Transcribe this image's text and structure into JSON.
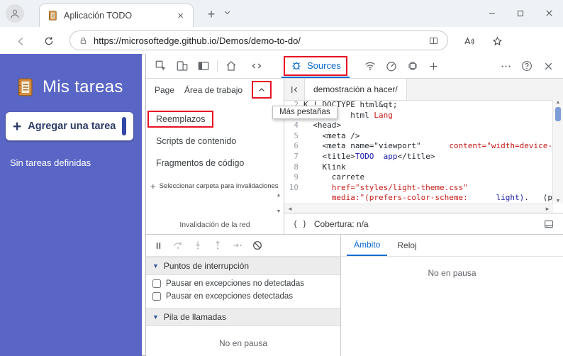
{
  "colors": {
    "accent": "#0b6bce",
    "annotation_red": "#e81123",
    "sidebar_blue": "#5a66c5",
    "string_red": "#c41a16",
    "value_blue": "#1a1aa6"
  },
  "titlebar": {
    "tab_title": "Aplicación TODO",
    "new_tab": "+",
    "tab_close": "×"
  },
  "navbar": {
    "url": "https://microsoftedge.github.io/Demos/demo-to-do/"
  },
  "todo_app": {
    "title": "Mis tareas",
    "plus": "+",
    "add_label": "Agregar una tarea",
    "empty": "Sin tareas definidas"
  },
  "devtools": {
    "toolbar": {
      "sources_label": "Sources"
    },
    "navigator": {
      "tabs": [
        "Page",
        "Área de trabajo"
      ],
      "more_tabs_tooltip": "Más pestañas",
      "items": [
        "Reemplazos",
        "Scripts de contenido",
        "Fragmentos de código"
      ],
      "select_folder_plus": "+",
      "select_folder": "Seleccionar carpeta para invalidaciones",
      "footer": "Invalidación de la red"
    },
    "editor": {
      "file_tab": "demostración a hacer/",
      "braces": "{ }",
      "coverage": "Cobertura: n/a",
      "lines": [
        {
          "num": "2",
          "segs": [
            [
              "K ! DOCTYPE html&qt;",
              "t"
            ]
          ]
        },
        {
          "num": "3",
          "segs": [
            [
              "          ",
              "t"
            ],
            [
              "html ",
              "t"
            ],
            [
              "Lang",
              "s"
            ]
          ]
        },
        {
          "num": "4",
          "segs": [
            [
              "  <head>",
              "t"
            ]
          ]
        },
        {
          "num": "5",
          "segs": [
            [
              "    <meta />",
              "t"
            ]
          ]
        },
        {
          "num": "6",
          "segs": [
            [
              "    <meta name=\"viewport\"",
              "t"
            ],
            [
              "      content=\"width=device-",
              "s"
            ]
          ]
        },
        {
          "num": "7",
          "segs": [
            [
              "    <tit1e>",
              "t"
            ],
            [
              "TODO  app",
              "b"
            ],
            [
              "</title>",
              "t"
            ]
          ]
        },
        {
          "num": "8",
          "segs": [
            [
              "    Klink",
              "t"
            ]
          ]
        },
        {
          "num": "9",
          "segs": [
            [
              "      carrete",
              "t"
            ]
          ]
        },
        {
          "num": "10",
          "segs": [
            [
              "      href=\"styles/light-theme.css\"",
              "s"
            ]
          ]
        },
        {
          "num": "",
          "segs": [
            [
              "      media:\"(prefers-color-scheme:",
              "s"
            ],
            [
              "      light)",
              "b"
            ],
            [
              ".   (pre",
              "t"
            ]
          ]
        }
      ]
    },
    "debugger": {
      "breakpoints_header": "Puntos de interrupción",
      "checkboxes": [
        "Pausar en excepciones no detectadas",
        "Pausar en excepciones detectadas"
      ],
      "callstack_header": "Pila de llamadas",
      "status": "No en pausa"
    },
    "scope": {
      "tabs": [
        "Ámbito",
        "Reloj"
      ],
      "status": "No en pausa"
    }
  }
}
